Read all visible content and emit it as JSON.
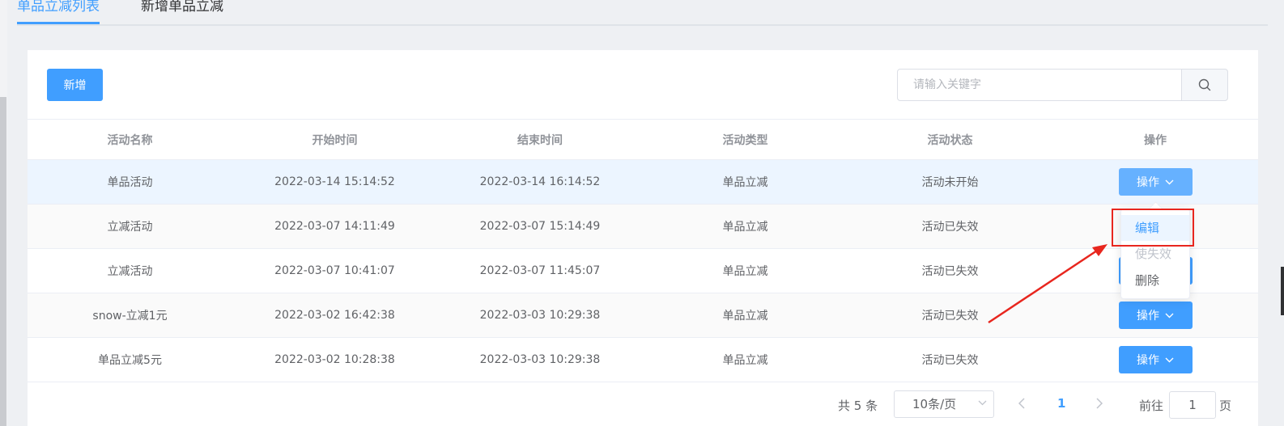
{
  "tabs": [
    {
      "label": "单品立减列表",
      "active": true
    },
    {
      "label": "新增单品立减",
      "active": false
    }
  ],
  "toolbar": {
    "add_label": "新增"
  },
  "search": {
    "placeholder": "请输入关键字",
    "icon": "search-icon"
  },
  "table": {
    "columns": [
      "活动名称",
      "开始时间",
      "结束时间",
      "活动类型",
      "活动状态",
      "操作"
    ],
    "rows": [
      {
        "name": "单品活动",
        "start": "2022-03-14 15:14:52",
        "end": "2022-03-14 16:14:52",
        "type": "单品立减",
        "status": "活动未开始",
        "action": "操作"
      },
      {
        "name": "立减活动",
        "start": "2022-03-07 14:11:49",
        "end": "2022-03-07 15:14:49",
        "type": "单品立减",
        "status": "活动已失效",
        "action": "操作"
      },
      {
        "name": "立减活动",
        "start": "2022-03-07 10:41:07",
        "end": "2022-03-07 11:45:07",
        "type": "单品立减",
        "status": "活动已失效",
        "action": "操作"
      },
      {
        "name": "snow-立减1元",
        "start": "2022-03-02 16:42:38",
        "end": "2022-03-03 10:29:38",
        "type": "单品立减",
        "status": "活动已失效",
        "action": "操作"
      },
      {
        "name": "单品立减5元",
        "start": "2022-03-02 10:28:38",
        "end": "2022-03-03 10:29:38",
        "type": "单品立减",
        "status": "活动已失效",
        "action": "操作"
      }
    ]
  },
  "dropdown": {
    "items": [
      {
        "label": "编辑",
        "state": "hover"
      },
      {
        "label": "使失效",
        "state": "disabled"
      },
      {
        "label": "删除",
        "state": "normal"
      }
    ]
  },
  "pagination": {
    "total": "共 5 条",
    "page_size": "10条/页",
    "current_page": "1",
    "goto_label": "前往",
    "goto_value": "1",
    "page_unit": "页"
  },
  "colors": {
    "primary": "#409eff",
    "annotation": "#e8261e",
    "row_hover": "#ecf5ff"
  }
}
